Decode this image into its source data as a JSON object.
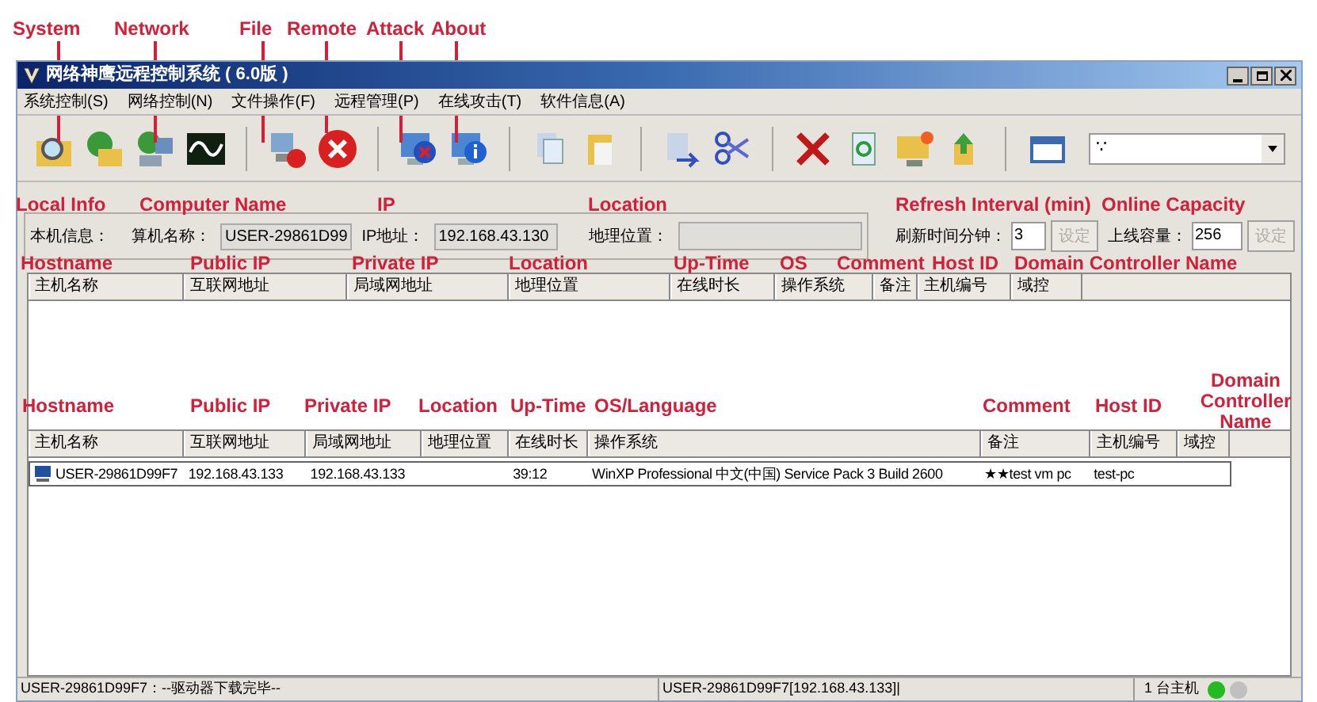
{
  "annotations": {
    "toolbar": [
      "System",
      "Network",
      "File",
      "Remote",
      "Attack",
      "About"
    ],
    "info": [
      "Local Info",
      "Computer Name",
      "IP",
      "Location",
      "Refresh Interval (min)",
      "Online Capacity"
    ],
    "upper_columns": [
      "Hostname",
      "Public IP",
      "Private IP",
      "Location",
      "Up-Time",
      "OS",
      "Comment",
      "Host ID",
      "Domain Controller Name"
    ],
    "lower_columns": [
      "Hostname",
      "Public IP",
      "Private IP",
      "Location",
      "Up-Time",
      "OS/Language",
      "Comment",
      "Host ID",
      "Domain Controller Name"
    ]
  },
  "window": {
    "title": "网络神鹰远程控制系统 ( 6.0版 )"
  },
  "menu": [
    "系统控制(S)",
    "网络控制(N)",
    "文件操作(F)",
    "远程管理(P)",
    "在线攻击(T)",
    "软件信息(A)"
  ],
  "toolbar": {
    "combo_value": "∵"
  },
  "local_info": {
    "label": "本机信息：",
    "computer_name_label": "算机名称：",
    "computer_name": "USER-29861D99",
    "ip_label": "IP地址：",
    "ip": "192.168.43.130",
    "location_label": "地理位置：",
    "refresh_label": "刷新时间分钟：",
    "refresh_value": "3",
    "refresh_button": {
      "label": "设定",
      "disabled": true
    },
    "capacity_label": "上线容量：",
    "capacity_value": "256",
    "capacity_button": {
      "label": "设定",
      "disabled": true
    }
  },
  "upper_table": {
    "columns": [
      "主机名称",
      "互联网地址",
      "局域网地址",
      "地理位置",
      "在线时长",
      "操作系统",
      "备注",
      "主机编号",
      "域控"
    ]
  },
  "lower_table": {
    "columns": [
      "主机名称",
      "互联网地址",
      "局域网地址",
      "地理位置",
      "在线时长",
      "操作系统",
      "备注",
      "主机编号",
      "域控"
    ],
    "rows": [
      {
        "hostname": "USER-29861D99F7",
        "public_ip": "192.168.43.133",
        "private_ip": "192.168.43.133",
        "uptime": "39:12",
        "os": "WinXP Professional 中文(中国) Service Pack 3 Build 2600",
        "comment": "★★test vm pc",
        "host_id": "test-pc",
        "selected": true
      }
    ]
  },
  "status_bar": {
    "message": "USER-29861D99F7：--驱动器下载完毕--",
    "host": "USER-29861D99F7[192.168.43.133]|",
    "count": "1 台主机",
    "indicators": [
      {
        "color": "#22bb22"
      },
      {
        "color": "#c0c0c0"
      }
    ]
  }
}
